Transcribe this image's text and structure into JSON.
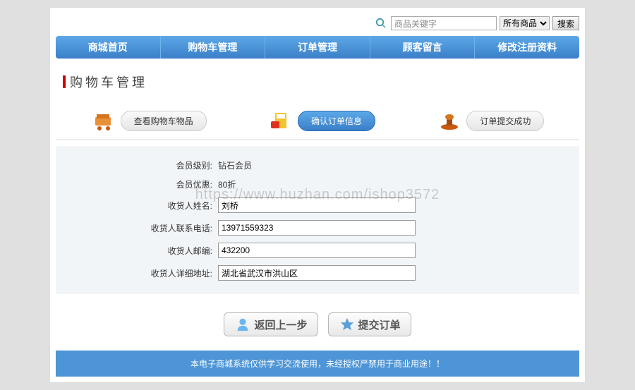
{
  "search": {
    "placeholder": "商品关键字",
    "category": "所有商品",
    "button": "搜索"
  },
  "nav": [
    "商城首页",
    "购物车管理",
    "订单管理",
    "顾客留言",
    "修改注册资料"
  ],
  "page_title": "购物车管理",
  "steps": {
    "s1": "查看购物车物品",
    "s2": "确认订单信息",
    "s3": "订单提交成功"
  },
  "form": {
    "labels": {
      "level": "会员级别:",
      "discount": "会员优惠:",
      "name": "收货人姓名:",
      "phone": "收货人联系电话:",
      "zip": "收货人邮编:",
      "address": "收货人详细地址:"
    },
    "values": {
      "level": "钻石会员",
      "discount": "80折",
      "name": "刘桥",
      "phone": "13971559323",
      "zip": "432200",
      "address": "湖北省武汉市洪山区"
    }
  },
  "actions": {
    "back": "返回上一步",
    "submit": "提交订单"
  },
  "footer": "本电子商城系统仅供学习交流使用，未经授权严禁用于商业用途！！",
  "watermark": "https://www.huzhan.com/ishop3572"
}
